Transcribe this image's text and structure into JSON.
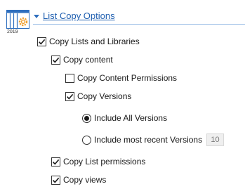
{
  "app": {
    "icon_year": "2019"
  },
  "section": {
    "title": "List Copy Options"
  },
  "options": {
    "copy_lists": {
      "label": "Copy Lists and Libraries",
      "checked": true
    },
    "copy_content": {
      "label": "Copy content",
      "checked": true
    },
    "copy_content_permissions": {
      "label": "Copy Content Permissions",
      "checked": false
    },
    "copy_versions": {
      "label": "Copy Versions",
      "checked": true
    },
    "include_all_versions": {
      "label": "Include All Versions",
      "selected": true
    },
    "include_recent_versions": {
      "label": "Include most recent Versions",
      "selected": false,
      "count": "10"
    },
    "copy_list_permissions": {
      "label": "Copy List permissions",
      "checked": true
    },
    "copy_views": {
      "label": "Copy views",
      "checked": true
    }
  },
  "colors": {
    "accent": "#1f5fb0",
    "rule": "#9cbfe6",
    "icon_orange": "#f0a030",
    "icon_blue": "#2f6fbe"
  }
}
